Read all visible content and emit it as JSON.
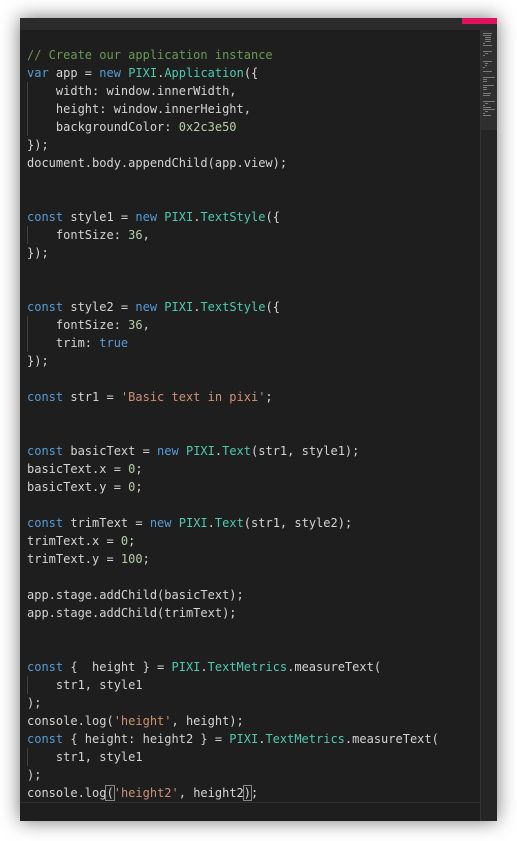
{
  "colors": {
    "accent": "#e0115f",
    "comment": "#6a9955",
    "keyword": "#569cd6",
    "type": "#4ec9b0",
    "number": "#b5cea8",
    "string": "#ce9178",
    "plain": "#d4d4d4"
  },
  "editor": {
    "language": "javascript",
    "lines": [
      [
        [
          "comment",
          "// Create our application instance"
        ]
      ],
      [
        [
          "keyword",
          "var"
        ],
        [
          "plain",
          " app = "
        ],
        [
          "keyword",
          "new"
        ],
        [
          "plain",
          " "
        ],
        [
          "type",
          "PIXI"
        ],
        [
          "plain",
          "."
        ],
        [
          "type",
          "Application"
        ],
        [
          "plain",
          "({"
        ]
      ],
      [
        [
          "plain",
          "    width: window.innerWidth,"
        ]
      ],
      [
        [
          "plain",
          "    height: window.innerHeight,"
        ]
      ],
      [
        [
          "plain",
          "    backgroundColor: "
        ],
        [
          "number",
          "0x2c3e50"
        ]
      ],
      [
        [
          "plain",
          "});"
        ]
      ],
      [
        [
          "plain",
          "document.body.appendChild(app.view);"
        ]
      ],
      [],
      [],
      [
        [
          "keyword",
          "const"
        ],
        [
          "plain",
          " style1 = "
        ],
        [
          "keyword",
          "new"
        ],
        [
          "plain",
          " "
        ],
        [
          "type",
          "PIXI"
        ],
        [
          "plain",
          "."
        ],
        [
          "type",
          "TextStyle"
        ],
        [
          "plain",
          "({"
        ]
      ],
      [
        [
          "plain",
          "    fontSize: "
        ],
        [
          "number",
          "36"
        ],
        [
          "plain",
          ","
        ]
      ],
      [
        [
          "plain",
          "});"
        ]
      ],
      [],
      [],
      [
        [
          "keyword",
          "const"
        ],
        [
          "plain",
          " style2 = "
        ],
        [
          "keyword",
          "new"
        ],
        [
          "plain",
          " "
        ],
        [
          "type",
          "PIXI"
        ],
        [
          "plain",
          "."
        ],
        [
          "type",
          "TextStyle"
        ],
        [
          "plain",
          "({"
        ]
      ],
      [
        [
          "plain",
          "    fontSize: "
        ],
        [
          "number",
          "36"
        ],
        [
          "plain",
          ","
        ]
      ],
      [
        [
          "plain",
          "    trim: "
        ],
        [
          "keyword",
          "true"
        ]
      ],
      [
        [
          "plain",
          "});"
        ]
      ],
      [],
      [
        [
          "keyword",
          "const"
        ],
        [
          "plain",
          " str1 = "
        ],
        [
          "string",
          "'Basic text in pixi'"
        ],
        [
          "plain",
          ";"
        ]
      ],
      [],
      [],
      [
        [
          "keyword",
          "const"
        ],
        [
          "plain",
          " basicText = "
        ],
        [
          "keyword",
          "new"
        ],
        [
          "plain",
          " "
        ],
        [
          "type",
          "PIXI"
        ],
        [
          "plain",
          "."
        ],
        [
          "type",
          "Text"
        ],
        [
          "plain",
          "(str1, style1);"
        ]
      ],
      [
        [
          "plain",
          "basicText.x = "
        ],
        [
          "number",
          "0"
        ],
        [
          "plain",
          ";"
        ]
      ],
      [
        [
          "plain",
          "basicText.y = "
        ],
        [
          "number",
          "0"
        ],
        [
          "plain",
          ";"
        ]
      ],
      [],
      [
        [
          "keyword",
          "const"
        ],
        [
          "plain",
          " trimText = "
        ],
        [
          "keyword",
          "new"
        ],
        [
          "plain",
          " "
        ],
        [
          "type",
          "PIXI"
        ],
        [
          "plain",
          "."
        ],
        [
          "type",
          "Text"
        ],
        [
          "plain",
          "(str1, style2);"
        ]
      ],
      [
        [
          "plain",
          "trimText.x = "
        ],
        [
          "number",
          "0"
        ],
        [
          "plain",
          ";"
        ]
      ],
      [
        [
          "plain",
          "trimText.y = "
        ],
        [
          "number",
          "100"
        ],
        [
          "plain",
          ";"
        ]
      ],
      [],
      [
        [
          "plain",
          "app.stage.addChild(basicText);"
        ]
      ],
      [
        [
          "plain",
          "app.stage.addChild(trimText);"
        ]
      ],
      [],
      [],
      [
        [
          "keyword",
          "const"
        ],
        [
          "plain",
          " {  height } = "
        ],
        [
          "type",
          "PIXI"
        ],
        [
          "plain",
          "."
        ],
        [
          "type",
          "TextMetrics"
        ],
        [
          "plain",
          ".measureText("
        ]
      ],
      [
        [
          "plain",
          "    str1, style1"
        ]
      ],
      [
        [
          "plain",
          ");"
        ]
      ],
      [
        [
          "plain",
          "console.log("
        ],
        [
          "string",
          "'height'"
        ],
        [
          "plain",
          ", height);"
        ]
      ],
      [
        [
          "keyword",
          "const"
        ],
        [
          "plain",
          " { height: height2 } = "
        ],
        [
          "type",
          "PIXI"
        ],
        [
          "plain",
          "."
        ],
        [
          "type",
          "TextMetrics"
        ],
        [
          "plain",
          ".measureText("
        ]
      ],
      [
        [
          "plain",
          "    str1, style1"
        ]
      ],
      [
        [
          "plain",
          ");"
        ]
      ],
      [
        [
          "plain",
          "console.log"
        ],
        [
          "paren",
          "("
        ],
        [
          "string",
          "'height2'"
        ],
        [
          "plain",
          ", height2"
        ],
        [
          "paren",
          ")"
        ],
        [
          "plain",
          ";"
        ]
      ]
    ]
  }
}
